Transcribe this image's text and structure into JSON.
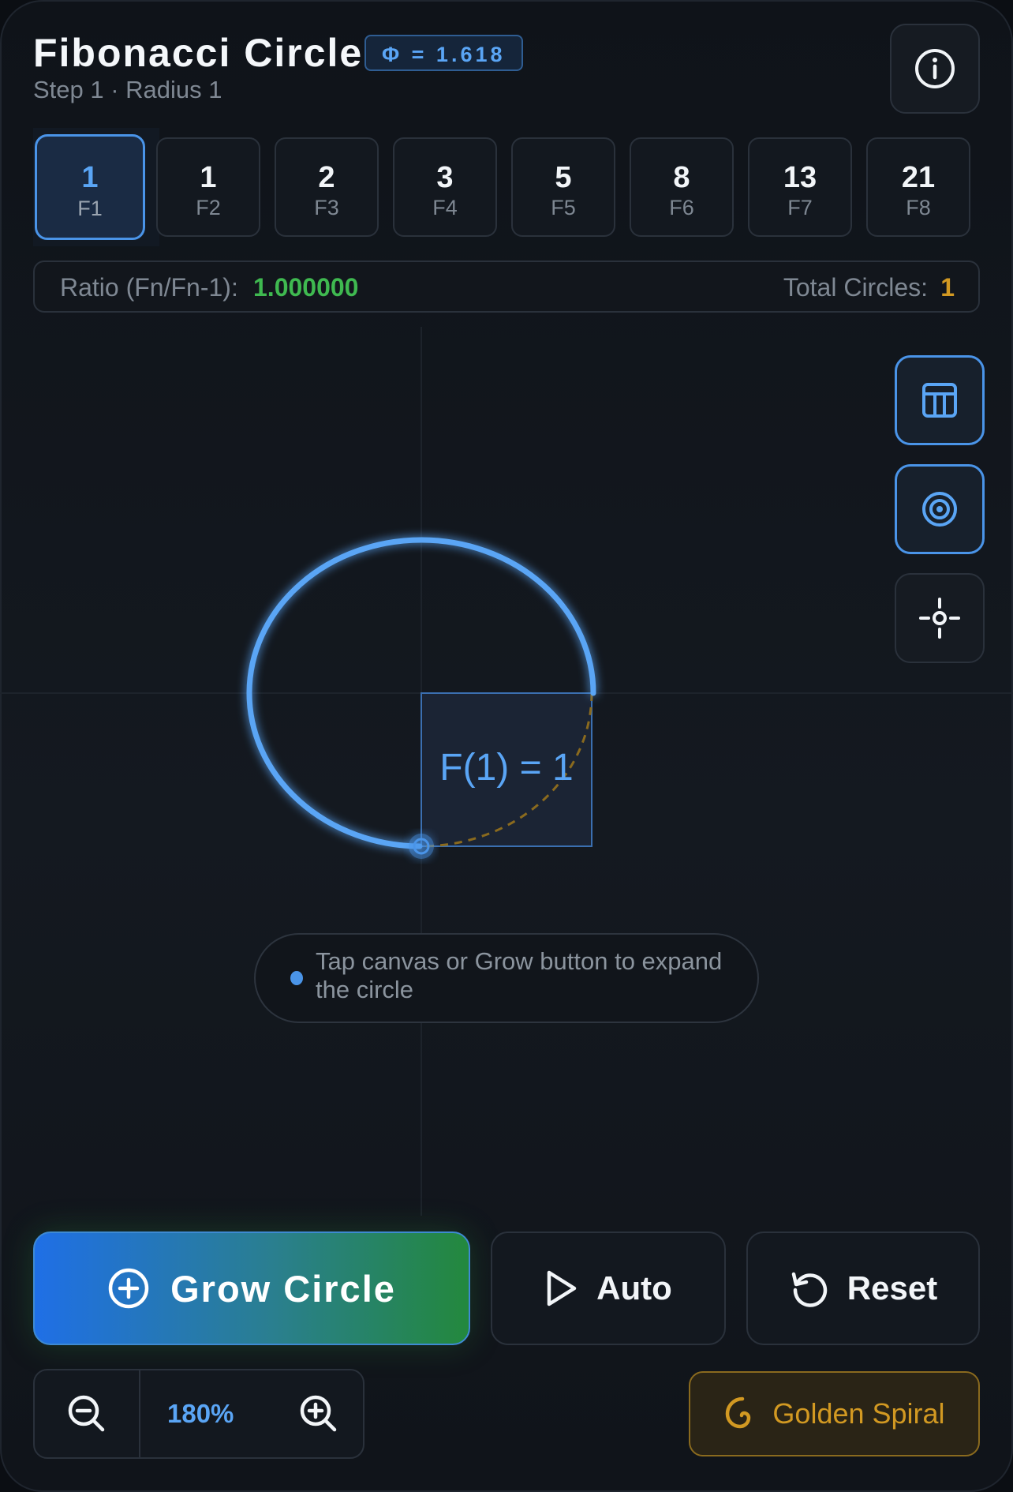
{
  "header": {
    "title": "Fibonacci Circle",
    "phi_badge": "Φ = 1.618",
    "subtitle": "Step 1 · Radius 1",
    "info_icon": "info-icon"
  },
  "fib_tabs": [
    {
      "value": "1",
      "label": "F1",
      "active": true
    },
    {
      "value": "1",
      "label": "F2",
      "active": false
    },
    {
      "value": "2",
      "label": "F3",
      "active": false
    },
    {
      "value": "3",
      "label": "F4",
      "active": false
    },
    {
      "value": "5",
      "label": "F5",
      "active": false
    },
    {
      "value": "8",
      "label": "F6",
      "active": false
    },
    {
      "value": "13",
      "label": "F7",
      "active": false
    },
    {
      "value": "21",
      "label": "F8",
      "active": false
    }
  ],
  "ratio_bar": {
    "ratio_label": "Ratio (Fn/Fn-1):",
    "ratio_value": "1.000000",
    "circles_label": "Total Circles:",
    "circles_value": "1"
  },
  "canvas": {
    "square_label": "F(1) = 1",
    "hint": "Tap canvas or Grow button to expand the circle",
    "side_buttons": [
      "grid-icon",
      "target-icon",
      "crosshair-icon"
    ]
  },
  "controls": {
    "grow_label": "Grow Circle",
    "auto_label": "Auto",
    "reset_label": "Reset",
    "zoom_value": "180%",
    "spiral_label": "Golden Spiral"
  },
  "colors": {
    "accent_blue": "#4a94e8",
    "ratio_green": "#3fb950",
    "gold": "#d29922",
    "background": "#0f1319"
  }
}
